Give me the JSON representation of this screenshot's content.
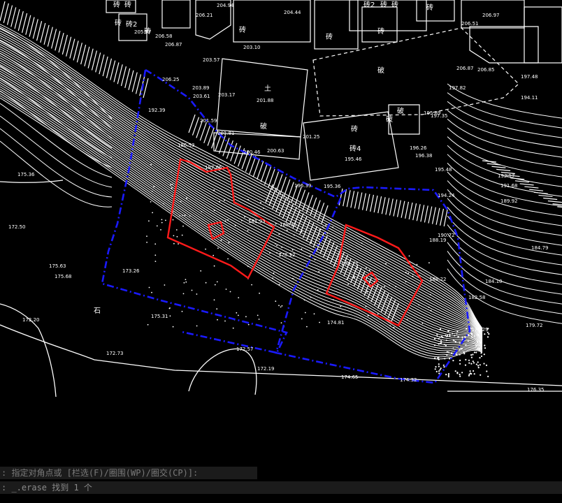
{
  "window": {
    "title": "CAD drawing viewport"
  },
  "colors": {
    "background": "#000000",
    "linework": "#ffffff",
    "boundary_blue": "#1a1aff",
    "parcel_red": "#ff1a1a",
    "command_bg": "#1b1b1b",
    "command_text": "#8a8a8a"
  },
  "command": {
    "line1": ": 指定对角点或 [栏选(F)/圈围(WP)/圈交(CP)]:",
    "line2": ": _.erase 找到 1 个"
  },
  "map": {
    "building_labels": [
      "砖",
      "砖",
      "砖2",
      "砖",
      "砖",
      "砖2",
      "砖",
      "砖",
      "砖",
      "砖",
      "砖",
      "砖",
      "土",
      "破",
      "破",
      "砖4",
      "砖",
      "破",
      "破",
      "石"
    ],
    "elevations": [
      "204.94",
      "204.44",
      "206.21",
      "206.58",
      "206.87",
      "203.57",
      "203.10",
      "205.97",
      "206.87",
      "206.25",
      "203.89",
      "203.61",
      "203.17",
      "201.88",
      "201.59",
      "201.81",
      "200.46",
      "200.63",
      "201.25",
      "195.46",
      "196.39",
      "195.36",
      "206.97",
      "206.51",
      "206.85",
      "197.48",
      "194.11",
      "195.48",
      "192.17",
      "191.68",
      "194.24",
      "189.92",
      "184.79",
      "184.10",
      "182.58",
      "179.72",
      "179.29",
      "176.35",
      "175.36",
      "172.50",
      "175.63",
      "175.68",
      "173.26",
      "172.20",
      "175.31",
      "172.73",
      "172.57",
      "172.19",
      "174.65",
      "174.32",
      "178.52",
      "179.17",
      "174.81",
      "186.53",
      "187.86",
      "181.93",
      "196.26",
      "196.38",
      "188.35",
      "188.19",
      "190.72",
      "188.22",
      "192.39",
      "197.82",
      "195.89",
      "197.35"
    ]
  }
}
